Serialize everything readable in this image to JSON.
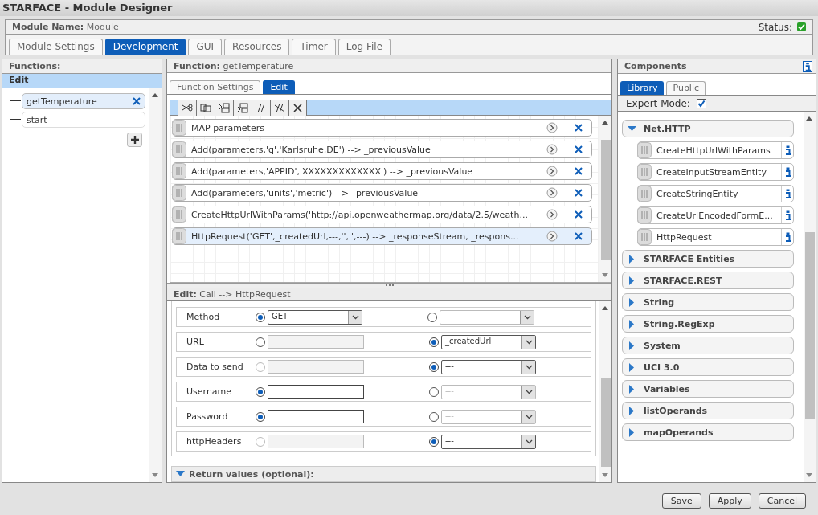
{
  "window": {
    "title": "STARFACE - Module Designer"
  },
  "module": {
    "label": "Module Name:",
    "name": "Module",
    "status_label": "Status:",
    "status_ok": true
  },
  "tabs": [
    {
      "label": "Module Settings",
      "selected": false
    },
    {
      "label": "Development",
      "selected": true
    },
    {
      "label": "GUI",
      "selected": false
    },
    {
      "label": "Resources",
      "selected": false
    },
    {
      "label": "Timer",
      "selected": false
    },
    {
      "label": "Log File",
      "selected": false
    }
  ],
  "functions_panel": {
    "title": "Functions:",
    "group": "Edit",
    "items": [
      {
        "label": "getTemperature",
        "selected": true
      },
      {
        "label": "start",
        "selected": false
      }
    ]
  },
  "function_panel": {
    "label": "Function:",
    "name": "getTemperature",
    "tabs": [
      {
        "label": "Function Settings",
        "selected": false
      },
      {
        "label": "Edit",
        "selected": true
      }
    ],
    "statements": [
      {
        "text": "MAP parameters",
        "selected": false
      },
      {
        "text": "Add(parameters,'q','Karlsruhe,DE') --> _previousValue",
        "selected": false
      },
      {
        "text": "Add(parameters,'APPID','XXXXXXXXXXXXX') --> _previousValue",
        "selected": false
      },
      {
        "text": "Add(parameters,'units','metric') --> _previousValue",
        "selected": false
      },
      {
        "text": "CreateHttpUrlWithParams('http://api.openweathermap.org/data/2.5/weath...",
        "selected": false
      },
      {
        "text": "HttpRequest('GET',_createdUrl,---,'','',---) --> _responseStream, _respons...",
        "selected": true
      }
    ]
  },
  "edit_panel": {
    "label": "Edit:",
    "title": "Call --> HttpRequest",
    "parameters": [
      {
        "name": "Method",
        "kind": "select",
        "value_selected": true,
        "value_disabled": false,
        "value": "GET",
        "variable_selected": false,
        "variable": "---"
      },
      {
        "name": "URL",
        "kind": "text",
        "value_selected": false,
        "value_disabled": false,
        "variable_selected": true,
        "variable": "_createdUrl"
      },
      {
        "name": "Data to send",
        "kind": "text",
        "value_selected": false,
        "value_disabled": true,
        "variable_selected": true,
        "variable": "---"
      },
      {
        "name": "Username",
        "kind": "text",
        "value_selected": true,
        "value_disabled": false,
        "variable_selected": false,
        "variable": "---"
      },
      {
        "name": "Password",
        "kind": "text",
        "value_selected": true,
        "value_disabled": false,
        "variable_selected": false,
        "variable": "---"
      },
      {
        "name": "httpHeaders",
        "kind": "text",
        "value_selected": false,
        "value_disabled": true,
        "variable_selected": true,
        "variable": "---"
      }
    ],
    "return_values": {
      "label": "Return values (optional):",
      "expanded": true
    }
  },
  "components_panel": {
    "title": "Components",
    "tabs": [
      {
        "label": "Library",
        "selected": true
      },
      {
        "label": "Public",
        "selected": false
      }
    ],
    "expert_mode": {
      "label": "Expert Mode:",
      "checked": true
    },
    "groups": [
      {
        "name": "Net.HTTP",
        "expanded": true,
        "children": [
          {
            "name": "CreateHttpUrlWithParams"
          },
          {
            "name": "CreateInputStreamEntity"
          },
          {
            "name": "CreateStringEntity"
          },
          {
            "name": "CreateUrlEncodedFormE..."
          },
          {
            "name": "HttpRequest"
          }
        ]
      },
      {
        "name": "STARFACE Entities",
        "expanded": false
      },
      {
        "name": "STARFACE.REST",
        "expanded": false
      },
      {
        "name": "String",
        "expanded": false
      },
      {
        "name": "String.RegExp",
        "expanded": false
      },
      {
        "name": "System",
        "expanded": false
      },
      {
        "name": "UCI 3.0",
        "expanded": false
      },
      {
        "name": "Variables",
        "expanded": false
      },
      {
        "name": "listOperands",
        "expanded": false
      },
      {
        "name": "mapOperands",
        "expanded": false
      }
    ]
  },
  "buttons": [
    "Save",
    "Apply",
    "Cancel"
  ]
}
